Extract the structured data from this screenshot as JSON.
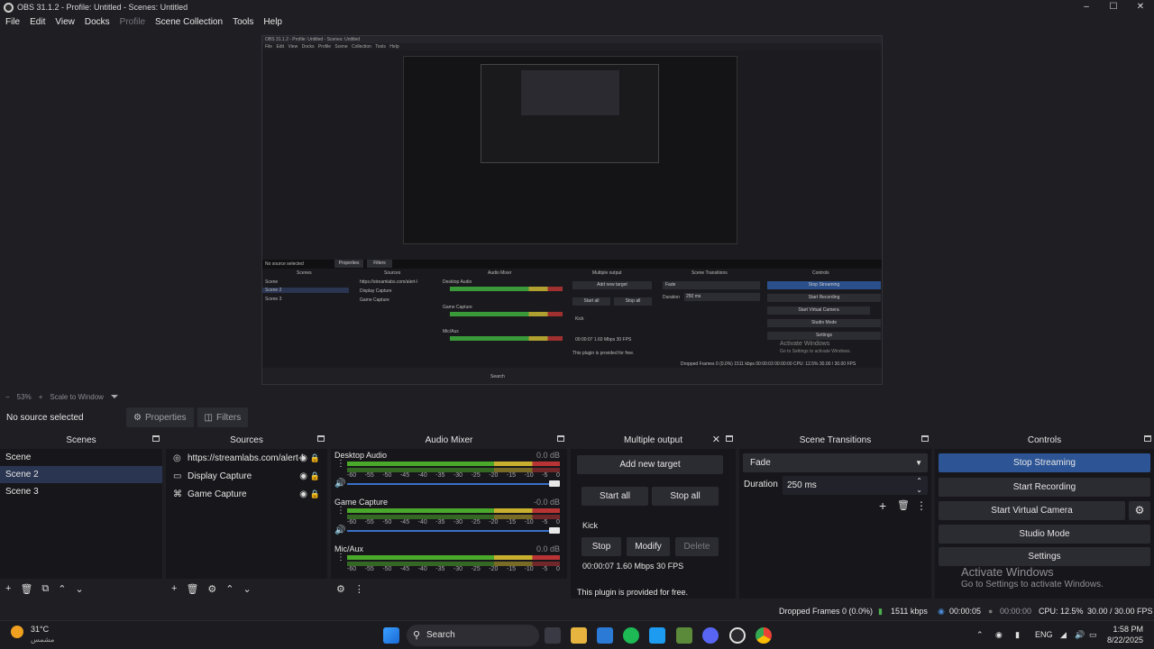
{
  "window": {
    "title": "OBS 31.1.2 - Profile: Untitled - Scenes: Untitled",
    "controls": [
      "–",
      "☐",
      "✕"
    ]
  },
  "menu": {
    "items": [
      "File",
      "Edit",
      "View",
      "Docks",
      "Profile",
      "Scene Collection",
      "Tools",
      "Help"
    ]
  },
  "preview": {
    "mini_title": "OBS 31.1.2 - Profile: Untitled - Scenes: Untitled",
    "mini_menu": "File Edit View Docks Profile Scene Collection Tools Help",
    "mini_no_source": "No source selected",
    "mini_properties": "Properties",
    "mini_filters": "Filters",
    "mini_docks": [
      "Scenes",
      "Sources",
      "Audio Mixer",
      "Multiple output",
      "Scene Transitions",
      "Controls"
    ],
    "mini_scenes": [
      "Scene",
      "Scene 2",
      "Scene 3"
    ],
    "mini_sources": [
      "https://streamlabs.com/alert-l",
      "Display Capture",
      "Game Capture"
    ],
    "mini_channels": [
      "Desktop Audio",
      "Game Capture",
      "Mic/Aux"
    ],
    "mini_mo_add": "Add new target",
    "mini_mo_start": "Start all",
    "mini_mo_stop": "Stop all",
    "mini_mo_kick": "Kick",
    "mini_mo_stats": "00:00:07  1.60 Mbps  30 FPS",
    "mini_mo_free": "This plugin is provided for free.",
    "mini_controls": [
      "Stop Streaming",
      "Start Recording",
      "Start Virtual Camera",
      "Studio Mode",
      "Settings"
    ],
    "mini_fade": "Fade",
    "mini_duration": "Duration",
    "mini_duration_val": "250 ms",
    "mini_activate": "Activate Windows",
    "mini_activate_sub": "Go to Settings to activate Windows.",
    "mini_status": "Dropped Frames 0 (0.0%)   1511 kbps   00:00:03   00:00:00   CPU: 12.5%   30.00 / 30.00 FPS",
    "mini_search": "Search"
  },
  "zoom": {
    "minus": "−",
    "level": "53%",
    "plus": "+",
    "mode": "Scale to Window"
  },
  "source_bar": {
    "no_source": "No source selected",
    "properties": "Properties",
    "filters": "Filters"
  },
  "scenes": {
    "title": "Scenes",
    "items": [
      "Scene",
      "Scene 2",
      "Scene 3"
    ],
    "selected_index": 1,
    "tools": [
      "+",
      "🗑",
      "⧉",
      "⌃",
      "⌄"
    ]
  },
  "sources": {
    "title": "Sources",
    "items": [
      {
        "icon": "globe-icon",
        "glyph": "◎",
        "label": "https://streamlabs.com/alert-l"
      },
      {
        "icon": "monitor-icon",
        "glyph": "▭",
        "label": "Display Capture"
      },
      {
        "icon": "gamepad-icon",
        "glyph": "⌘",
        "label": "Game Capture"
      }
    ],
    "tools": [
      "+",
      "🗑",
      "⚙",
      "⌃",
      "⌄"
    ]
  },
  "mixer": {
    "title": "Audio Mixer",
    "channels": [
      {
        "name": "Desktop Audio",
        "db": "0.0 dB"
      },
      {
        "name": "Game Capture",
        "db": "-0.0 dB"
      },
      {
        "name": "Mic/Aux",
        "db": "0.0 dB"
      }
    ],
    "ticks": [
      "-60",
      "-55",
      "-50",
      "-45",
      "-40",
      "-35",
      "-30",
      "-25",
      "-20",
      "-15",
      "-10",
      "-5",
      "0"
    ]
  },
  "multi_output": {
    "title": "Multiple output",
    "add_target": "Add new target",
    "start_all": "Start all",
    "stop_all": "Stop all",
    "target_name": "Kick",
    "stop": "Stop",
    "modify": "Modify",
    "delete": "Delete",
    "stats": "00:00:07  1.60 Mbps  30 FPS",
    "footer": "This plugin is provided for free."
  },
  "transitions": {
    "title": "Scene Transitions",
    "selected": "Fade",
    "duration_label": "Duration",
    "duration_value": "250 ms"
  },
  "controls": {
    "title": "Controls",
    "stop_streaming": "Stop Streaming",
    "start_recording": "Start Recording",
    "start_virtual_camera": "Start Virtual Camera",
    "studio_mode": "Studio Mode",
    "settings": "Settings"
  },
  "activation": {
    "title": "Activate Windows",
    "subtitle": "Go to Settings to activate Windows."
  },
  "status": {
    "dropped_frames": "Dropped Frames 0 (0.0%)",
    "bitrate": "1511 kbps",
    "stream_time": "00:00:05",
    "record_time": "00:00:00",
    "cpu": "CPU: 12.5%",
    "fps": "30.00 / 30.00 FPS"
  },
  "taskbar": {
    "weather_temp": "31°C",
    "weather_desc": "مشمس",
    "search": "Search",
    "language": "ENG",
    "time": "1:58 PM",
    "date": "8/22/2025"
  },
  "colors": {
    "accent": "#2d5596",
    "selected_row": "#2a3552",
    "meter_green": "#4aa82a",
    "meter_yellow": "#c8b02e",
    "meter_red": "#b83434"
  }
}
